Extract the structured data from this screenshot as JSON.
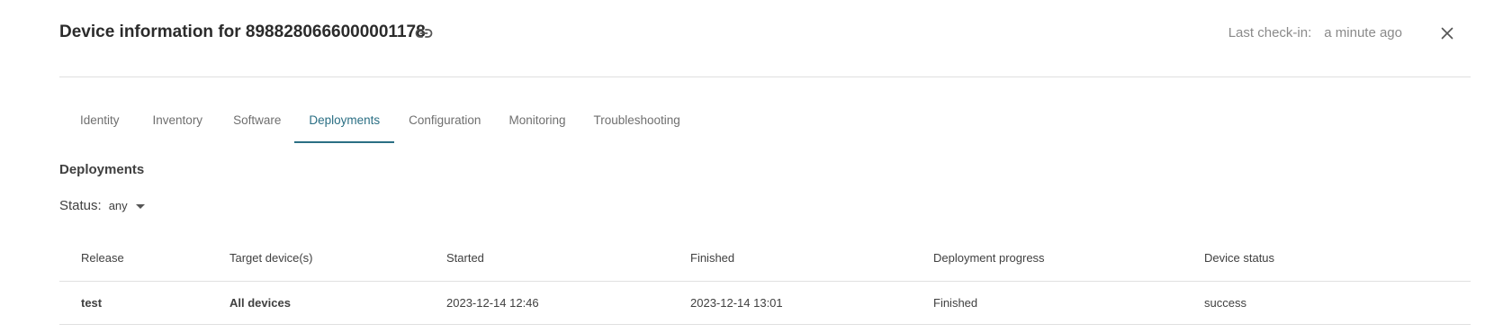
{
  "header": {
    "title": "Device information for 8988280666000001178",
    "checkin_label": "Last check-in:",
    "checkin_value": "a minute ago"
  },
  "tabs": [
    {
      "label": "Identity"
    },
    {
      "label": "Inventory"
    },
    {
      "label": "Software"
    },
    {
      "label": "Deployments",
      "active": true
    },
    {
      "label": "Configuration"
    },
    {
      "label": "Monitoring"
    },
    {
      "label": "Troubleshooting"
    }
  ],
  "section": {
    "title": "Deployments",
    "status_label": "Status:",
    "status_value": "any"
  },
  "table": {
    "columns": [
      "Release",
      "Target device(s)",
      "Started",
      "Finished",
      "Deployment progress",
      "Device status"
    ],
    "rows": [
      {
        "release": "test",
        "target": "All devices",
        "started": "2023-12-14 12:46",
        "finished": "2023-12-14 13:01",
        "progress": "Finished",
        "device_status": "success"
      }
    ]
  },
  "colors": {
    "accent": "#2b6f84",
    "text": "#404040",
    "muted": "#8a8a8a",
    "divider": "#e0e0e0"
  },
  "icons": [
    "link-icon",
    "close-icon",
    "chevron-down-icon"
  ]
}
